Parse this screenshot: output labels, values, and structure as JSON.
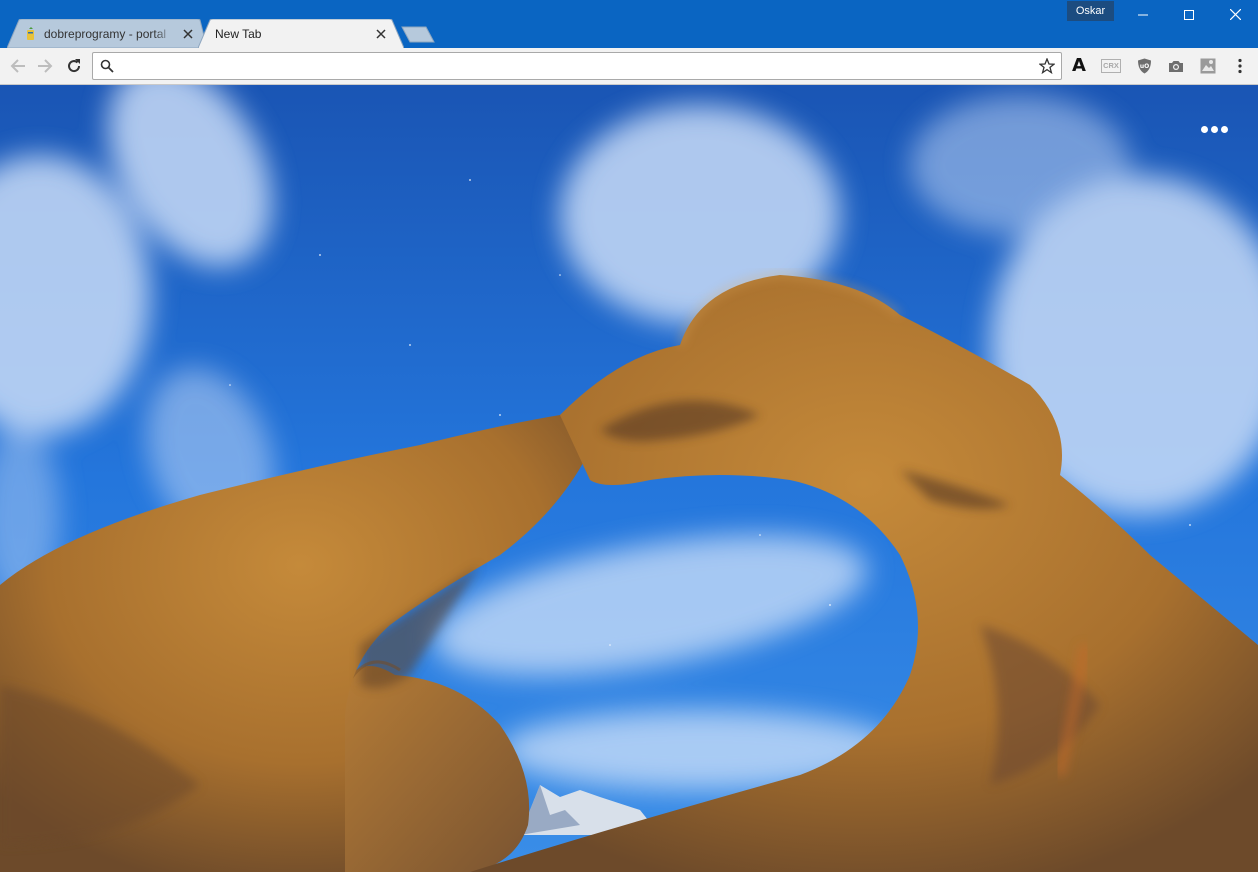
{
  "window": {
    "profile_name": "Oskar",
    "controls": {
      "minimize_icon": "minimize-icon",
      "maximize_icon": "maximize-icon",
      "close_icon": "close-icon"
    }
  },
  "tabs": [
    {
      "title": "dobreprogramy - portal",
      "active": false,
      "favicon": "dobreprogramy-favicon"
    },
    {
      "title": "New Tab",
      "active": true
    }
  ],
  "toolbar": {
    "omnibox": {
      "value": "",
      "placeholder": ""
    },
    "icons": [
      "back-arrow-icon",
      "forward-arrow-icon",
      "reload-icon",
      "search-icon",
      "bookmark-star-icon",
      "extension-a-icon",
      "crx-extension-icon",
      "ublock-icon",
      "camera-icon",
      "image-extension-icon",
      "chrome-menu-icon"
    ],
    "crx_label": "CRX"
  },
  "new_tab_page": {
    "background": "rock arch under starry blue sky",
    "more_menu_icon": "more-horizontal-icon"
  },
  "colors": {
    "titlebar": "#0a65c2",
    "toolbar": "#f2f2f2",
    "sky": "#1f6fd6",
    "rock": "#b8782f"
  }
}
